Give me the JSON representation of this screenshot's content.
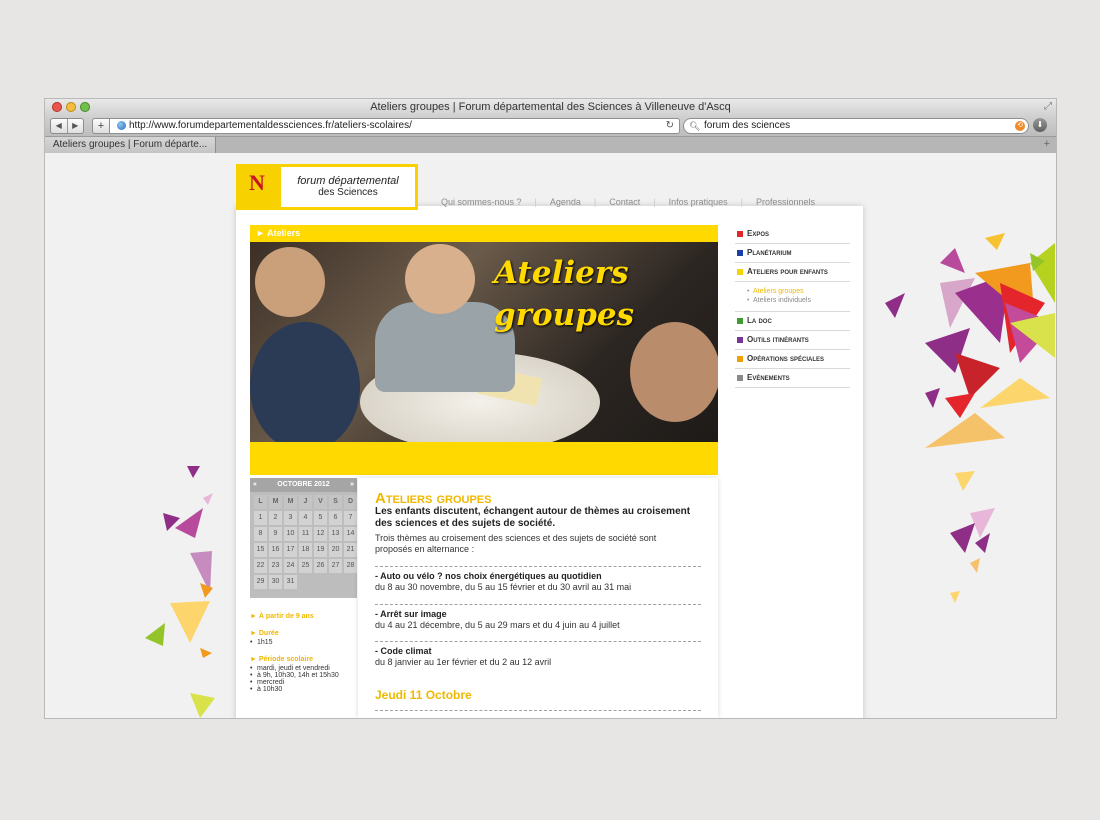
{
  "browser": {
    "window_title": "Ateliers groupes | Forum départemental des Sciences à Villeneuve d'Ascq",
    "url": "http://www.forumdepartementaldessciences.fr/ateliers-scolaires/",
    "search_value": "forum des sciences",
    "tab_label": "Ateliers groupes | Forum départe..."
  },
  "site": {
    "logo_line1": "forum départemental",
    "logo_line2": "des Sciences",
    "logo_letter": "N",
    "top_nav": [
      "Qui sommes-nous ?",
      "Agenda",
      "Contact",
      "Infos pratiques",
      "Professionnels"
    ],
    "breadcrumb": "► Ateliers",
    "banner_title_line1": "Ateliers",
    "banner_title_line2": "groupes"
  },
  "calendar": {
    "month": "OCTOBRE 2012",
    "prev": "«",
    "next": "»",
    "weekdays": [
      "L",
      "M",
      "M",
      "J",
      "V",
      "S",
      "D"
    ],
    "days": [
      "1",
      "2",
      "3",
      "4",
      "5",
      "6",
      "7",
      "8",
      "9",
      "10",
      "11",
      "12",
      "13",
      "14",
      "15",
      "16",
      "17",
      "18",
      "19",
      "20",
      "21",
      "22",
      "23",
      "24",
      "25",
      "26",
      "27",
      "28",
      "29",
      "30",
      "31"
    ]
  },
  "info": {
    "age_label": "► À partir de 9 ans",
    "duration_label": "► Durée",
    "duration_value": "1h15",
    "period_label": "► Période scolaire",
    "period_items": [
      "mardi, jeudi et vendredi",
      "à 9h, 10h30, 14h et 15h30",
      "mercredi",
      "à 10h30"
    ]
  },
  "content": {
    "title": "Ateliers groupes",
    "lead": "Les enfants discutent, échangent autour de thèmes au croisement des sciences et des sujets de société.",
    "intro": "Trois thèmes au croisement des sciences et des sujets de société sont proposés en alternance :",
    "themes": [
      {
        "title": "- Auto ou vélo ? nos choix énergétiques au quotidien",
        "dates": "du 8 au 30 novembre, du 5 au 15 février et du 30 avril au 31 mai"
      },
      {
        "title": "- Arrêt sur image",
        "dates": "du 4 au 21 décembre, du 5 au 29 mars et du 4 juin au 4 juillet"
      },
      {
        "title": "- Code climat",
        "dates": "du 8 janvier au 1er février et du 2 au 12 avril"
      }
    ],
    "date_heading": "Jeudi 11 Octobre"
  },
  "right_nav": {
    "items": [
      {
        "label": "Expos",
        "color": "#e3262c"
      },
      {
        "label": "Planétarium",
        "color": "#1a3fa8"
      },
      {
        "label": "Ateliers pour enfants",
        "color": "#f5d300"
      },
      {
        "label": "La doc",
        "color": "#3f9d2f"
      },
      {
        "label": "Outils itinérants",
        "color": "#7a3592"
      },
      {
        "label": "Opérations spéciales",
        "color": "#f0a000"
      },
      {
        "label": "Evènements",
        "color": "#8a8a8a"
      }
    ],
    "sub_items": [
      "Ateliers groupes",
      "Ateliers individuels"
    ]
  }
}
